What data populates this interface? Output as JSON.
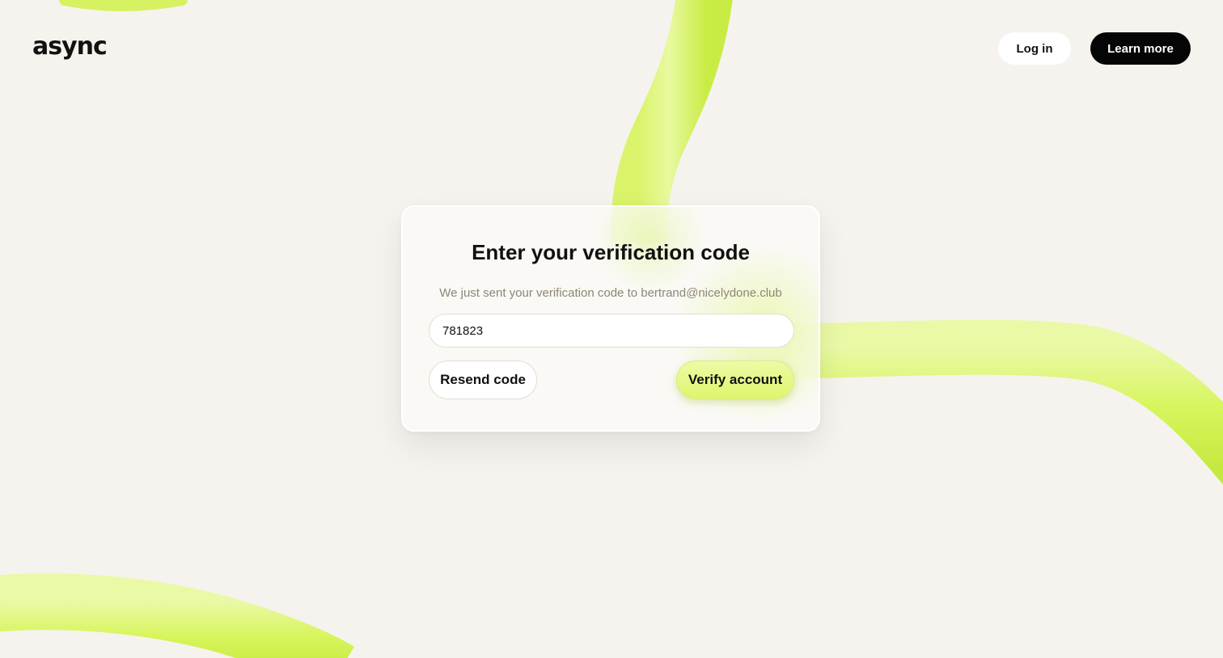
{
  "header": {
    "logo_text": "async",
    "login_label": "Log in",
    "learn_more_label": "Learn more"
  },
  "verification": {
    "title": "Enter your verification code",
    "subtitle": "We just sent your verification code to bertrand@nicelydone.club",
    "code_value": "781823",
    "resend_label": "Resend code",
    "verify_label": "Verify account"
  },
  "colors": {
    "background": "#f6f3ee",
    "accent_lime": "#def56c",
    "dark_button": "#050505",
    "subtitle_text": "#8f8676"
  }
}
